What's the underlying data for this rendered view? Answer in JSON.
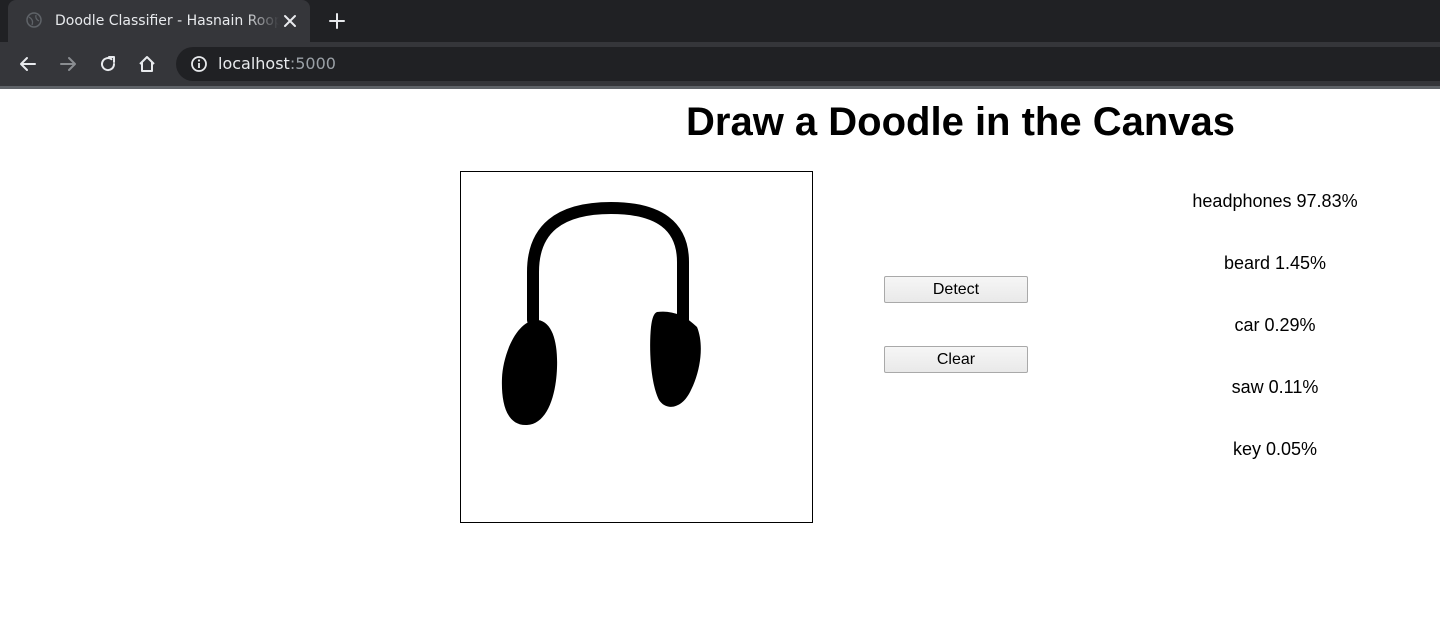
{
  "browser": {
    "tab_title": "Doodle Classifier - Hasnain Roopawalla",
    "url_host": "localhost",
    "url_port": ":5000",
    "icons": {
      "favicon": "globe-icon",
      "close": "close-icon",
      "new_tab": "plus-icon",
      "back": "arrow-left-icon",
      "forward": "arrow-right-icon",
      "reload": "reload-icon",
      "home": "home-icon",
      "site_info": "info-icon"
    },
    "colors": {
      "tabstrip": "#202124",
      "toolbar": "#35363a"
    }
  },
  "page": {
    "title": "Draw a Doodle in the Canvas",
    "buttons": {
      "detect": "Detect",
      "clear": "Clear"
    },
    "predictions": [
      {
        "label": "headphones",
        "percent": "97.83%"
      },
      {
        "label": "beard",
        "percent": "1.45%"
      },
      {
        "label": "car",
        "percent": "0.29%"
      },
      {
        "label": "saw",
        "percent": "0.11%"
      },
      {
        "label": "key",
        "percent": "0.05%"
      }
    ]
  }
}
